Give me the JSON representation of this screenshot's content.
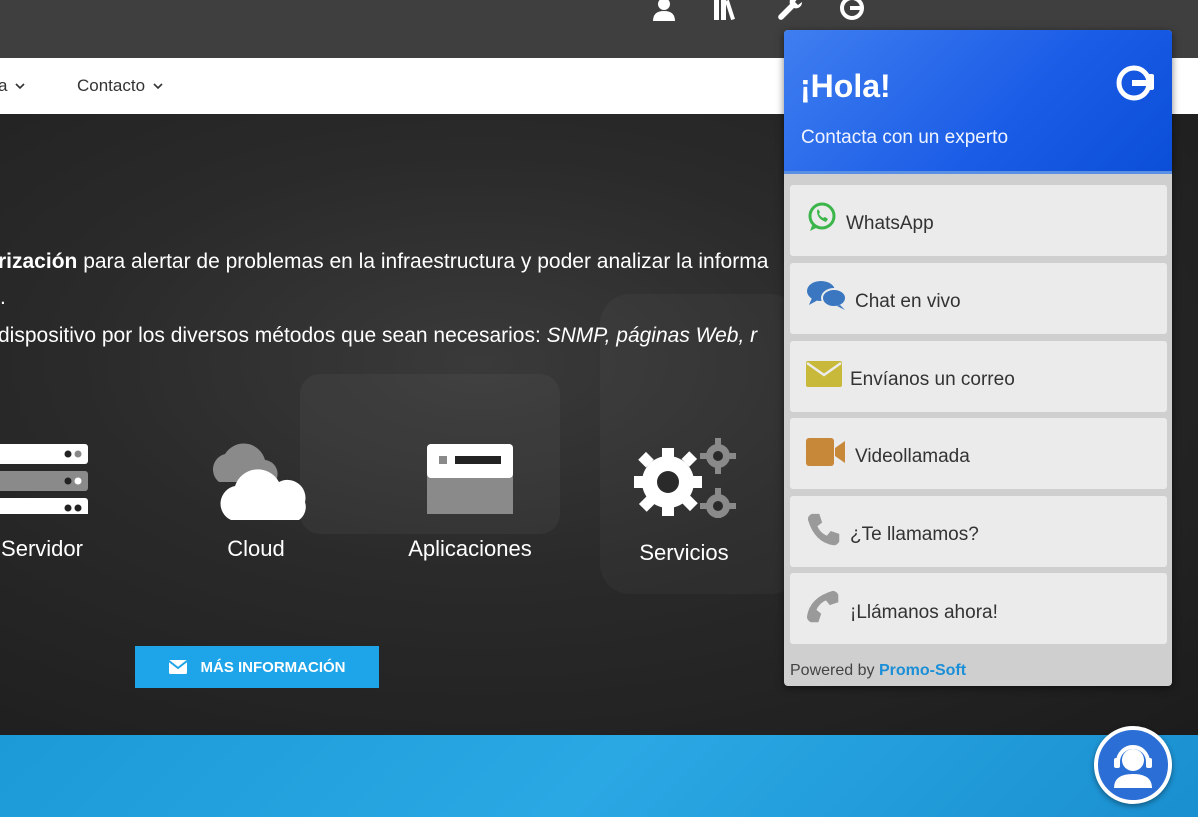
{
  "topbar": {
    "icons": [
      "user-icon",
      "library-icon",
      "wrench-icon",
      "support-logo-icon"
    ]
  },
  "nav": {
    "item_partial": "a",
    "contact": "Contacto"
  },
  "hero": {
    "line1_bold": "rización",
    "line1_rest": " para alertar de problemas en la infraestructura y poder analizar la informa",
    "line1_dot": ".",
    "line2_prefix": "dispositivo por los diversos métodos que sean necesarios: ",
    "line2_italic": "SNMP, páginas Web, r",
    "features": [
      {
        "label": "Servidor",
        "icon": "server-icon"
      },
      {
        "label": "Cloud",
        "icon": "cloud-icon"
      },
      {
        "label": "Aplicaciones",
        "icon": "application-window-icon"
      },
      {
        "label": "Servicios",
        "icon": "gears-icon"
      }
    ],
    "cta": "MÁS INFORMACIÓN"
  },
  "widget": {
    "title": "¡Hola!",
    "subtitle": "Contacta con un experto",
    "options": [
      {
        "label": "WhatsApp",
        "icon": "whatsapp-icon",
        "color": "#3cb54a"
      },
      {
        "label": "Chat en vivo",
        "icon": "chat-bubbles-icon",
        "color": "#3a77c0"
      },
      {
        "label": "Envíanos un correo",
        "icon": "envelope-icon",
        "color": "#c9b93a"
      },
      {
        "label": "Videollamada",
        "icon": "video-camera-icon",
        "color": "#c8883a"
      },
      {
        "label": "¿Te llamamos?",
        "icon": "phone-icon",
        "color": "#9a9a9a"
      },
      {
        "label": "¡Llámanos ahora!",
        "icon": "phone-icon",
        "color": "#9a9a9a"
      }
    ],
    "powered_prefix": "Powered by ",
    "powered_brand": "Promo-Soft"
  },
  "colors": {
    "accent": "#1ea4e8",
    "widget_header": "#1a5ce6",
    "footer": "#1c9ad8"
  }
}
